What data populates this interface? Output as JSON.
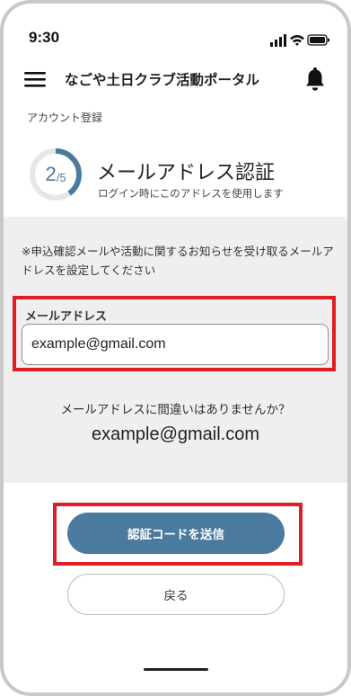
{
  "status_bar": {
    "time": "9:30",
    "icons": [
      "signal-icon",
      "wifi-icon",
      "battery-icon"
    ]
  },
  "header": {
    "menu_icon": "hamburger-menu-icon",
    "title": "なごや土日クラブ活動ポータル",
    "notification_icon": "bell-icon"
  },
  "breadcrumb": "アカウント登録",
  "step": {
    "current": "2",
    "total": "/5",
    "progress_fraction": 0.4
  },
  "section": {
    "title": "メールアドレス認証",
    "subtitle": "ログイン時にこのアドレスを使用します"
  },
  "notice": "※申込確認メールや活動に関するお知らせを受け取るメールアドレスを設定してください",
  "email_field": {
    "label": "メールアドレス",
    "value": "example@gmail.com"
  },
  "confirmation": {
    "question": "メールアドレスに間違いはありませんか？",
    "email": "example@gmail.com"
  },
  "buttons": {
    "send_code": "認証コードを送信",
    "back": "戻る"
  },
  "colors": {
    "accent": "#4a7a9e",
    "highlight": "#e01c24",
    "panel_bg": "#efefef"
  }
}
